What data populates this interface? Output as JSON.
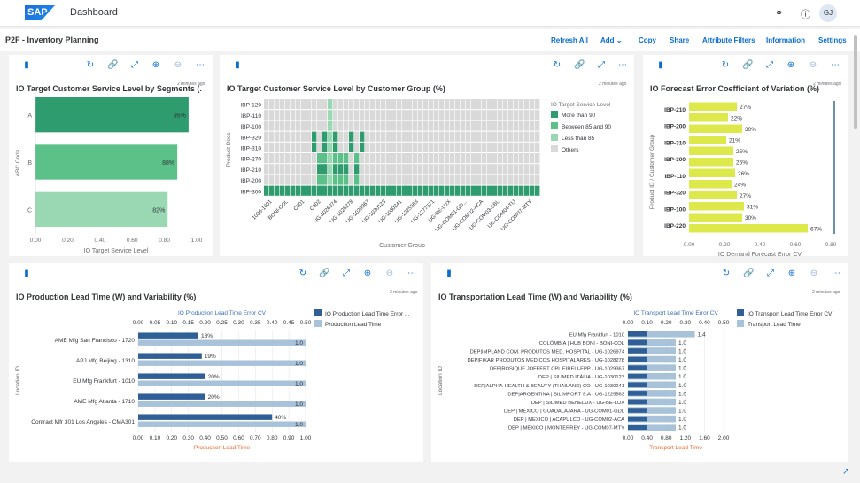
{
  "shell": {
    "logo": "SAP",
    "title": "Dashboard",
    "avatar": "GJ"
  },
  "story": {
    "title": "P2F - Inventory Planning",
    "actions": [
      "Refresh All",
      "Add ⌄",
      "Copy",
      "Share",
      "Attribute Filters",
      "Information",
      "Settings"
    ]
  },
  "colors": {
    "accent": "#0a6ed1",
    "green_dark": "#2e9c6e",
    "green_mid": "#5bc189",
    "green_light": "#9ad8b4",
    "grey": "#d9d9d9",
    "yellow": "#dde84a",
    "navy": "#2f5f96",
    "lightblue": "#a8c2d9"
  },
  "cards": {
    "c1": {
      "title": "IO Target Customer Service Level by Segments (...",
      "timestamp": "2 minutes ago",
      "chart_data": {
        "type": "bar",
        "categories": [
          "A",
          "B",
          "C"
        ],
        "values": [
          0.95,
          0.88,
          0.82
        ],
        "value_labels": [
          "95%",
          "88%",
          "82%"
        ],
        "xlabel": "IO Target Service Level",
        "ylabel": "ABC Code",
        "xlim": [
          0,
          1
        ],
        "xticks": [
          "0.00",
          "0.20",
          "0.40",
          "0.60",
          "0.80",
          "1.00"
        ]
      }
    },
    "c2": {
      "title": "IO Target Customer Service Level by Customer Group (%)",
      "timestamp": "2 minutes ago",
      "chart_data": {
        "type": "heatmap",
        "rows": [
          "IBP-120",
          "IBP-110",
          "IBP-100",
          "IBP-320",
          "IBP-310",
          "IBP-270",
          "IBP-210",
          "IBP-200",
          "IBP-300"
        ],
        "xlabel": "Customer Group",
        "ylabel": "Product Desc",
        "columns": [
          "1006-1001",
          "BONI-COL",
          "C001",
          "C002",
          "UG-1026974",
          "UG-1028278",
          "UG-1029367",
          "UG-1030123",
          "UG-1030241",
          "UG-1225563",
          "UG-1277571",
          "UG-BE-LUX",
          "UG-COM01-GD...",
          "UG-COM02-ACA",
          "UG-COM03-SBL",
          "UG-COM04-TIJ",
          "UG-COM07-MTY"
        ],
        "legend_title": "IO Target Service Level",
        "legend": [
          "More than 90",
          "Between 85 and 90",
          "Less than 85",
          "Others"
        ]
      }
    },
    "c3": {
      "title": "IO Forecast Error Coefficient of Variation (%)",
      "timestamp": "2 minutes ago",
      "chart_data": {
        "type": "bar",
        "categories": [
          "IBP-210",
          "IBP-200",
          "IBP-310",
          "IBP-300",
          "IBP-110",
          "IBP-320",
          "IBP-100",
          "IBP-220"
        ],
        "value_labels": [
          "27%",
          "22%",
          "30%",
          "21%",
          "25%",
          "25%",
          "26%",
          "24%",
          "27%",
          "31%",
          "30%",
          "67%"
        ],
        "values": [
          0.27,
          0.22,
          0.3,
          0.21,
          0.25,
          0.25,
          0.26,
          0.24,
          0.27,
          0.31,
          0.3,
          0.67
        ],
        "xlabel": "IO Demand Forecast Error CV",
        "ylabel": "Product ID / Customer Group",
        "xlim": [
          0,
          0.8
        ],
        "xticks": [
          "0.00",
          "0.20",
          "0.40",
          "0.60",
          "0.80"
        ]
      }
    },
    "c4": {
      "title": "IO Production Lead Time (W) and Variability (%)",
      "timestamp": "2 minutes ago",
      "chart_data": {
        "type": "bar",
        "categories": [
          "AME Mfg San Francisco - 1720",
          "APJ Mfg Beijing - 1310",
          "EU Mfg Frankfurt - 1010",
          "AME Mfg Atlanta - 1710",
          "Contract Mfr 301 Los Angeles - CMA301"
        ],
        "series": [
          {
            "name": "IO Production Lead Time Error ...",
            "values": [
              0.18,
              0.19,
              0.2,
              0.2,
              0.4
            ],
            "labels": [
              "18%",
              "19%",
              "20%",
              "20%",
              "40%"
            ]
          },
          {
            "name": "Production Lead Time",
            "values": [
              1.0,
              1.0,
              1.0,
              1.0,
              1.0
            ],
            "labels": [
              "1.0",
              "1.0",
              "1.0",
              "1.0",
              "1.0"
            ]
          }
        ],
        "top_axis_label": "IO Production Lead Time Error CV",
        "top_ticks": [
          "0.00",
          "0.05",
          "0.10",
          "0.15",
          "0.20",
          "0.25",
          "0.30",
          "0.35",
          "0.40",
          "0.45",
          "0.50"
        ],
        "bottom_axis_label": "Production Lead Time",
        "bottom_ticks": [
          "0.00",
          "0.10",
          "0.20",
          "0.30",
          "0.40",
          "0.50",
          "0.60",
          "0.70",
          "0.80",
          "0.90",
          "1.00"
        ],
        "ylabel": "Location ID"
      }
    },
    "c5": {
      "title": "IO Transportation Lead Time (W) and Variability (%)",
      "timestamp": "2 minutes ago",
      "chart_data": {
        "type": "bar",
        "categories": [
          "EU Mfg Frankfurt - 1010",
          "COLÓMBIA | HUB BONI - BONI-COL",
          "DEP|IMPLAND COM. PRODUTOS MED. HOSPITAL - UG-1026974",
          "DEP|FIXAR PRODUTOS MEDICOS HOSPITALARES - UG-1028278",
          "DEP|ROSIQUE JOFFERT CPL EIRELI-EPP - UG-1029367",
          "DEP | SILIMED ITÁLIA - UG-1030123",
          "DEP|ALPHA-HEALTH & BEAUTY (THAILAND) CO - UG-1030241",
          "DEP|ARGENTINA | SILIMPORT S.A - UG-1225563",
          "DEP | SILIMED BENELUX - UG-BE-LUX",
          "DEP | MÉXICO | GUADALAJARA - UG-COM01-GDL",
          "DEP | MÉXICO | ACAPULCO - UG-COM02-ACA",
          "DEP | MÉXICO | MONTERREY - UG-COM07-MTY"
        ],
        "series": [
          {
            "name": "IO Transport Lead Time Error CV",
            "values": [
              0.1,
              0.1,
              0.1,
              0.1,
              0.1,
              0.1,
              0.1,
              0.1,
              0.1,
              0.1,
              0.1,
              0.1
            ]
          },
          {
            "name": "Transport Lead Time",
            "values": [
              1.4,
              1.0,
              1.0,
              1.0,
              1.0,
              1.0,
              1.0,
              1.0,
              1.0,
              1.0,
              1.0,
              1.0
            ],
            "labels": [
              "1.4",
              "1.0",
              "1.0",
              "1.0",
              "1.0",
              "1.0",
              "1.0",
              "1.0",
              "1.0",
              "1.0",
              "1.0",
              "1.0"
            ]
          }
        ],
        "top_axis_label": "IO Transport Lead Time Error CV",
        "top_ticks": [
          "0.00",
          "0.10",
          "0.20",
          "0.30",
          "0.40",
          "0.50"
        ],
        "bottom_axis_label": "Transport Lead Time",
        "bottom_ticks": [
          "0.00",
          "0.40",
          "0.80",
          "1.20",
          "1.60",
          "2.00"
        ],
        "ylabel": "Location ID"
      }
    }
  }
}
